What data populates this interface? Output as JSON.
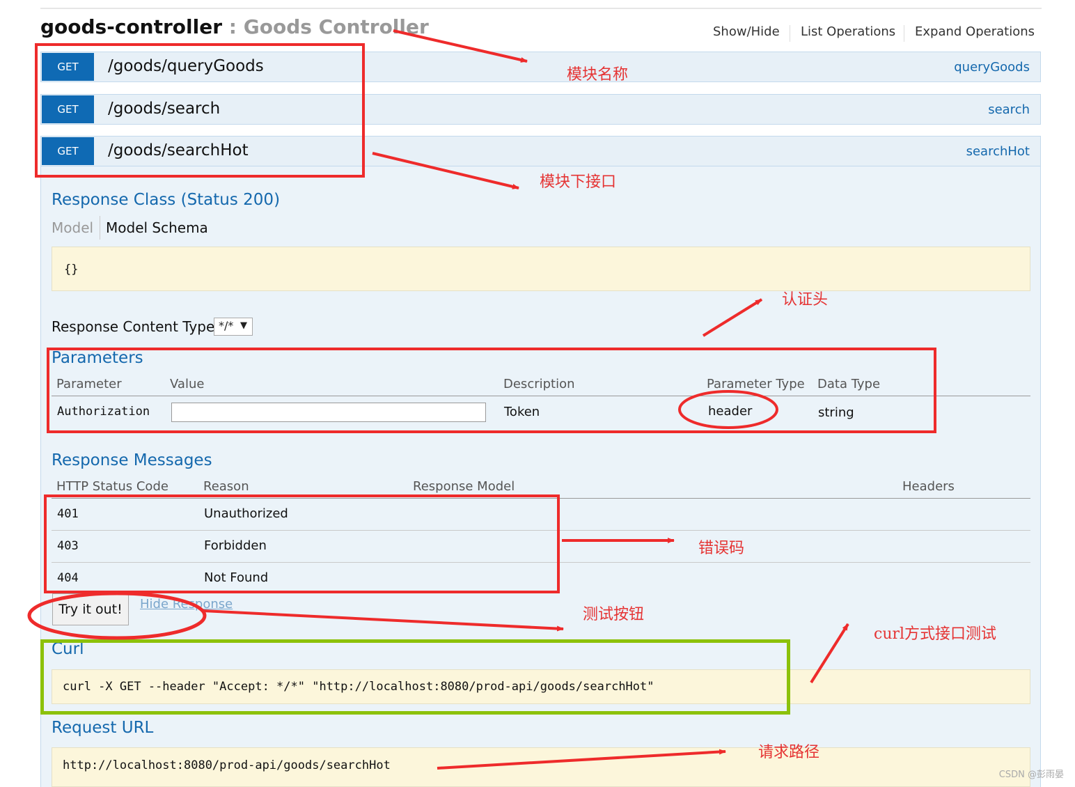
{
  "controller": {
    "name": "goods-controller",
    "separator": " : ",
    "description": "Goods Controller"
  },
  "operations_links": {
    "show_hide": "Show/Hide",
    "list_operations": "List Operations",
    "expand_operations": "Expand Operations"
  },
  "operations": [
    {
      "method": "GET",
      "path": "/goods/queryGoods",
      "nickname": "queryGoods"
    },
    {
      "method": "GET",
      "path": "/goods/search",
      "nickname": "search"
    },
    {
      "method": "GET",
      "path": "/goods/searchHot",
      "nickname": "searchHot"
    }
  ],
  "response_class": {
    "title": "Response Class (Status 200)",
    "tab_model": "Model",
    "tab_schema": "Model Schema",
    "schema": "{}"
  },
  "content_type": {
    "label": "Response Content Type",
    "selected": "*/*"
  },
  "parameters": {
    "title": "Parameters",
    "headers": [
      "Parameter",
      "Value",
      "Description",
      "Parameter Type",
      "Data Type"
    ],
    "rows": [
      {
        "name": "Authorization",
        "value": "",
        "description": "Token",
        "param_type": "header",
        "data_type": "string"
      }
    ]
  },
  "response_messages": {
    "title": "Response Messages",
    "headers": [
      "HTTP Status Code",
      "Reason",
      "Response Model",
      "Headers"
    ],
    "rows": [
      {
        "code": "401",
        "reason": "Unauthorized"
      },
      {
        "code": "403",
        "reason": "Forbidden"
      },
      {
        "code": "404",
        "reason": "Not Found"
      }
    ]
  },
  "actions": {
    "try_it_out": "Try it out!",
    "hide_response": "Hide Response"
  },
  "curl": {
    "title": "Curl",
    "command": "curl -X GET --header \"Accept: */*\" \"http://localhost:8080/prod-api/goods/searchHot\""
  },
  "request_url": {
    "title": "Request URL",
    "url": "http://localhost:8080/prod-api/goods/searchHot"
  },
  "annotations": {
    "module_name": "模块名称",
    "module_apis": "模块下接口",
    "auth_header": "认证头",
    "error_codes": "错误码",
    "test_button": "测试按钮",
    "curl_test": "curl方式接口测试",
    "request_path": "请求路径"
  },
  "colors": {
    "get_badge": "#0f6ab4",
    "link": "#1468ad",
    "annotation_red": "#ee2b2b",
    "annotation_green": "#8cc10a",
    "code_bg": "#fcf6db"
  },
  "watermark": "CSDN @彭雨晏"
}
